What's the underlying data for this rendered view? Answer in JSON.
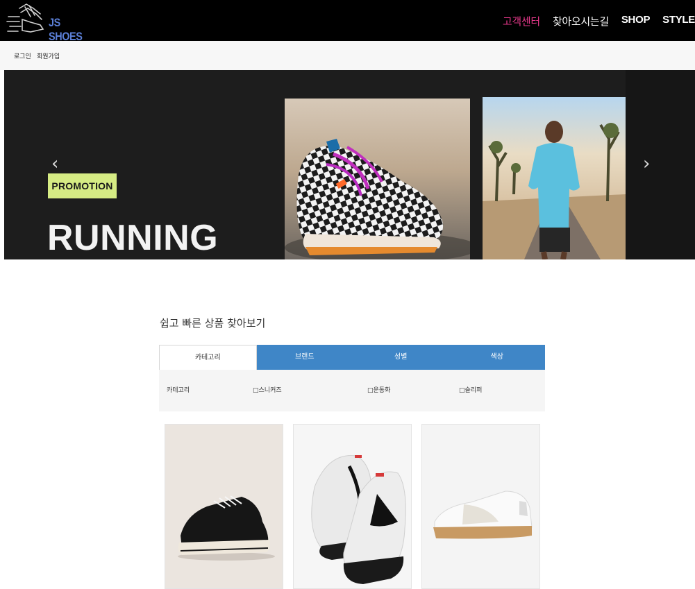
{
  "header": {
    "brand": "JS SHOES",
    "nav": [
      {
        "label": "고객센터"
      },
      {
        "label": "찾아오시는길"
      },
      {
        "label": "SHOP"
      },
      {
        "label": "STYLE"
      }
    ]
  },
  "subbar": {
    "login": "로그인",
    "signup": "회원가입"
  },
  "hero": {
    "badge": "PROMOTION",
    "title": "RUNNING",
    "prev_arrow": "‹",
    "next_arrow": "›"
  },
  "quick_search": {
    "title": "쉽고 빠른 상품 찾아보기",
    "tabs": [
      {
        "label": "카테고리"
      },
      {
        "label": "브랜드"
      },
      {
        "label": "성별"
      },
      {
        "label": "색상"
      }
    ],
    "filter": {
      "label": "카테고리",
      "options": [
        {
          "label": "□스니커즈"
        },
        {
          "label": "□운동화"
        },
        {
          "label": "□슬리퍼"
        }
      ]
    }
  },
  "colors": {
    "header_bg": "#000000",
    "accent_pink": "#e5388a",
    "tab_blue": "#3f86c7",
    "promo_green": "#d6ec84"
  }
}
